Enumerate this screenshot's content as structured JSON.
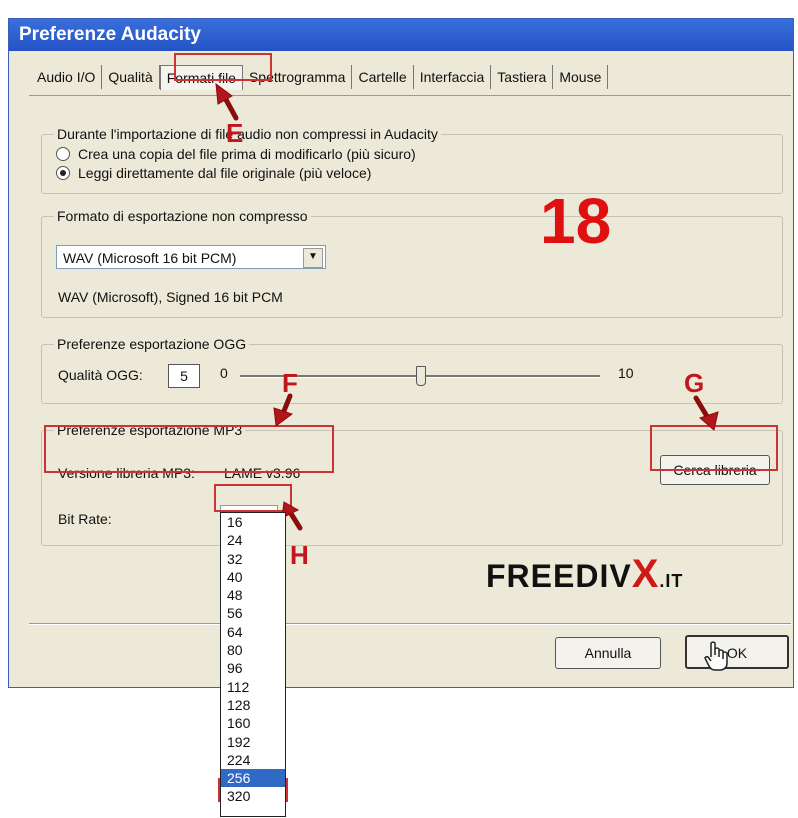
{
  "window": {
    "title": "Preferenze Audacity"
  },
  "tabs": [
    "Audio I/O",
    "Qualità",
    "Formati file",
    "Spettrogramma",
    "Cartelle",
    "Interfaccia",
    "Tastiera",
    "Mouse"
  ],
  "active_tab": "Formati file",
  "import_group": {
    "legend": "Durante l'importazione di file audio non compressi in Audacity",
    "option1": "Crea una copia del file prima di modificarlo (più sicuro)",
    "option2": "Leggi direttamente dal file originale (più veloce)",
    "selected": 2
  },
  "export_group": {
    "legend": "Formato di esportazione non compresso",
    "format_value": "WAV (Microsoft 16 bit PCM)",
    "format_desc": "WAV (Microsoft), Signed 16 bit PCM"
  },
  "ogg_group": {
    "legend": "Preferenze esportazione OGG",
    "quality_label": "Qualità OGG:",
    "quality_value": "5",
    "min": "0",
    "max": "10",
    "level": 0.5
  },
  "mp3_group": {
    "legend": "Preferenze esportazione MP3",
    "version_label": "Versione libreria MP3:",
    "version_value": "LAME v3.96",
    "find_button": "Cerca libreria",
    "bitrate_label": "Bit Rate:",
    "bitrate_value": "256",
    "bitrate_options": [
      "16",
      "24",
      "32",
      "40",
      "48",
      "56",
      "64",
      "80",
      "96",
      "112",
      "128",
      "160",
      "192",
      "224",
      "256",
      "320"
    ]
  },
  "buttons": {
    "cancel": "Annulla",
    "ok": "OK"
  },
  "annotations": {
    "step": "18",
    "e": "E",
    "f": "F",
    "g": "G",
    "h": "H"
  },
  "logo": {
    "part1": "FREEDIV",
    "part2": "X",
    "part3": ".IT"
  },
  "colors": {
    "titlebar": "#2453c6",
    "accent_red": "#c0161c",
    "selection": "#316ac5"
  }
}
